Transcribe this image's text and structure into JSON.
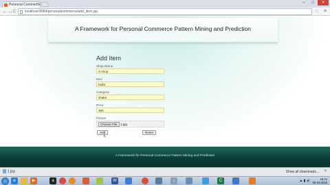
{
  "browser": {
    "tab_title": "Personal Commerce",
    "tab_close": "×",
    "url": "localhost:8084/personalcommerce/add_item.jsp",
    "nav_back": "←",
    "nav_forward": "→",
    "nav_reload": "C",
    "star": "☆",
    "menu": "≡",
    "win_min": "–",
    "win_max": "□",
    "win_close": "×"
  },
  "page": {
    "header_title": "A Framework for Personal Commerce Pattern Mining and Prediction",
    "form_title": "Add Item",
    "fields": [
      {
        "label": "Shop Name",
        "value": "S shop"
      },
      {
        "label": "Item",
        "value": "bulbt"
      },
      {
        "label": "Category",
        "value": "shake"
      },
      {
        "label": "Price",
        "value": "300"
      }
    ],
    "picture_label": "Picture",
    "choose_file_label": "Choose File",
    "file_name": "1.jpg",
    "add_label": "Add",
    "reset_label": "Reset",
    "footer_text": "A Framework for Personal Commerce Pattern Mining and Prediction"
  },
  "download_bar": {
    "file_name": "1.jpg",
    "show_all_label": "Show all downloads...",
    "close": "×"
  },
  "taskbar": {
    "apps": [
      "ie",
      "folder",
      "media",
      "amazon",
      "chrome",
      "firefox",
      "paint",
      "word",
      "excel",
      "chrome2",
      "tool",
      "music",
      "network",
      "settings",
      "cmd",
      "browser2",
      "java"
    ],
    "clock_time": "18:12",
    "clock_date": "08-10-2015"
  },
  "colors": {
    "field_bg": "#fdfbc8",
    "footer": "#0c3d35",
    "glow": "#c6ebe4"
  }
}
